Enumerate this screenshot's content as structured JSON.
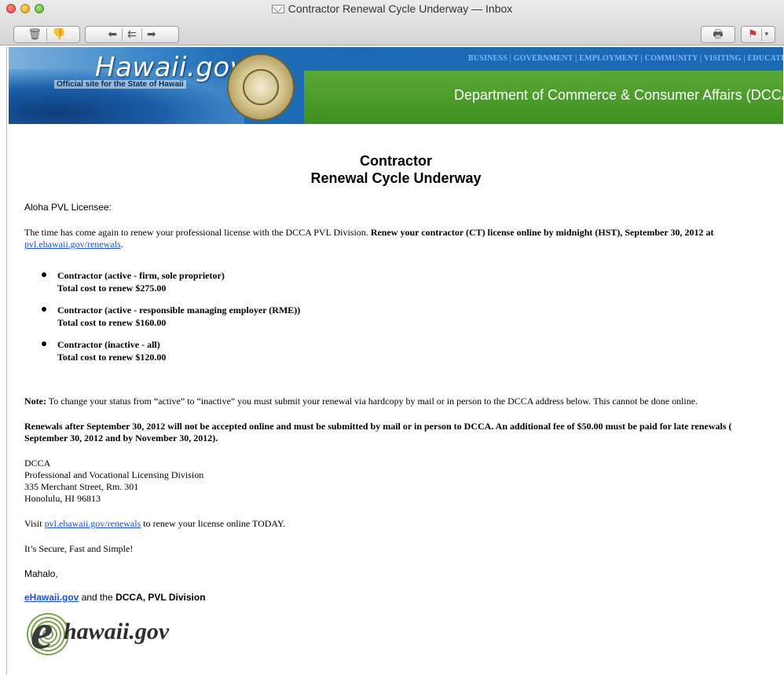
{
  "window": {
    "title": "Contractor Renewal Cycle Underway — Inbox"
  },
  "toolbar": {
    "delete_icon": "trash-icon",
    "junk_icon": "thumbs-down-icon",
    "reply_icon": "reply-arrow-icon",
    "reply_all_icon": "reply-all-arrow-icon",
    "forward_icon": "forward-arrow-icon",
    "print_icon": "printer-icon",
    "flag_icon": "flag-icon",
    "flag_color": "#d0342c"
  },
  "banner": {
    "logo_text": "Hawaii.gov",
    "official_text": "Official site for the State of Hawaii",
    "nav_text": "BUSINESS | GOVERNMENT | EMPLOYMENT | COMMUNITY | VISITING | EDUCATION",
    "department": "Department of Commerce & Consumer Affairs (DCCA)",
    "seal_icon": "state-seal-icon",
    "colors": {
      "blue": "#1c68b3",
      "green": "#4a9b2a",
      "nav": "#7db7ff"
    }
  },
  "email": {
    "headline_line1": "Contractor",
    "headline_line2": "Renewal Cycle Underway",
    "greeting": "Aloha PVL Licensee:",
    "intro_plain": "The time has come again to renew your professional license with the DCCA PVL Division. ",
    "intro_bold": "Renew your contractor (CT) license online by midnight (HST), September 30, 2012",
    "intro_tail": " at",
    "intro_link": "pvl.ehawaii.gov/renewals",
    "intro_period": ".",
    "bullets": [
      {
        "title": "Contractor (active - firm, sole proprietor)",
        "cost": "Total cost to renew $275.00"
      },
      {
        "title": "Contractor (active - responsible managing employer (RME))",
        "cost": "Total cost to renew $160.00"
      },
      {
        "title": "Contractor (inactive - all)",
        "cost": "Total cost to renew $120.00"
      }
    ],
    "note_label": "Note:",
    "note_text": " To change your status from “active” to “inactive” you must submit your renewal via hardcopy by mail or in person to the DCCA address below. This cannot be done online.",
    "late_line1": "Renewals after September 30, 2012 will not be accepted online and must be submitted by mail or in person to DCCA.  An additional fee of $50.00 must be paid for late renewals (",
    "late_line2": "September 30, 2012 and by November 30, 2012).",
    "address": [
      "DCCA",
      "Professional and Vocational Licensing Division",
      "335 Merchant Street, Rm. 301",
      "Honolulu, HI 96813"
    ],
    "visit_prefix": "Visit ",
    "visit_link": "pvl.ehawaii.gov/renewals",
    "visit_suffix": " to renew your license online TODAY.",
    "tagline": "It’s Secure, Fast and Simple!",
    "signoff": "Mahalo,",
    "sig_link": "eHawaii.gov",
    "sig_mid": " and the ",
    "sig_bold": "DCCA, PVL Division",
    "logo_e": "e",
    "logo_text": "hawaii.gov"
  }
}
